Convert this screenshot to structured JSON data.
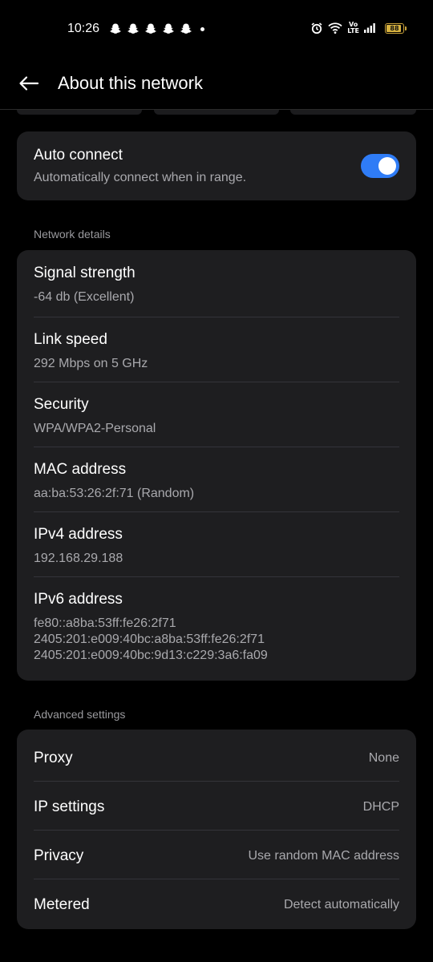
{
  "status_bar": {
    "time": "10:26",
    "notification_icons": [
      "snapchat-icon",
      "snapchat-icon",
      "snapchat-icon",
      "snapchat-icon",
      "snapchat-icon"
    ],
    "battery_level": "88",
    "volte_label": "Vo\nLTE"
  },
  "header": {
    "title": "About this network"
  },
  "auto_connect": {
    "title": "Auto connect",
    "subtitle": "Automatically connect when in range.",
    "enabled": true
  },
  "network_details": {
    "section_label": "Network details",
    "signal_strength": {
      "label": "Signal strength",
      "value": "-64 db (Excellent)"
    },
    "link_speed": {
      "label": "Link speed",
      "value": "292 Mbps on 5 GHz"
    },
    "security": {
      "label": "Security",
      "value": "WPA/WPA2-Personal"
    },
    "mac_address": {
      "label": "MAC address",
      "value": "aa:ba:53:26:2f:71 (Random)"
    },
    "ipv4": {
      "label": "IPv4 address",
      "value": "192.168.29.188"
    },
    "ipv6": {
      "label": "IPv6 address",
      "values": [
        "fe80::a8ba:53ff:fe26:2f71",
        "2405:201:e009:40bc:a8ba:53ff:fe26:2f71",
        "2405:201:e009:40bc:9d13:c229:3a6:fa09"
      ]
    }
  },
  "advanced_settings": {
    "section_label": "Advanced settings",
    "proxy": {
      "label": "Proxy",
      "value": "None"
    },
    "ip_settings": {
      "label": "IP settings",
      "value": "DHCP"
    },
    "privacy": {
      "label": "Privacy",
      "value": "Use random MAC address"
    },
    "metered": {
      "label": "Metered",
      "value": "Detect automatically"
    }
  },
  "colors": {
    "background": "#000000",
    "card": "#1e1e20",
    "accent_toggle": "#2f7cf6",
    "secondary_text": "#a9a9ad",
    "battery": "#d8b23f"
  }
}
